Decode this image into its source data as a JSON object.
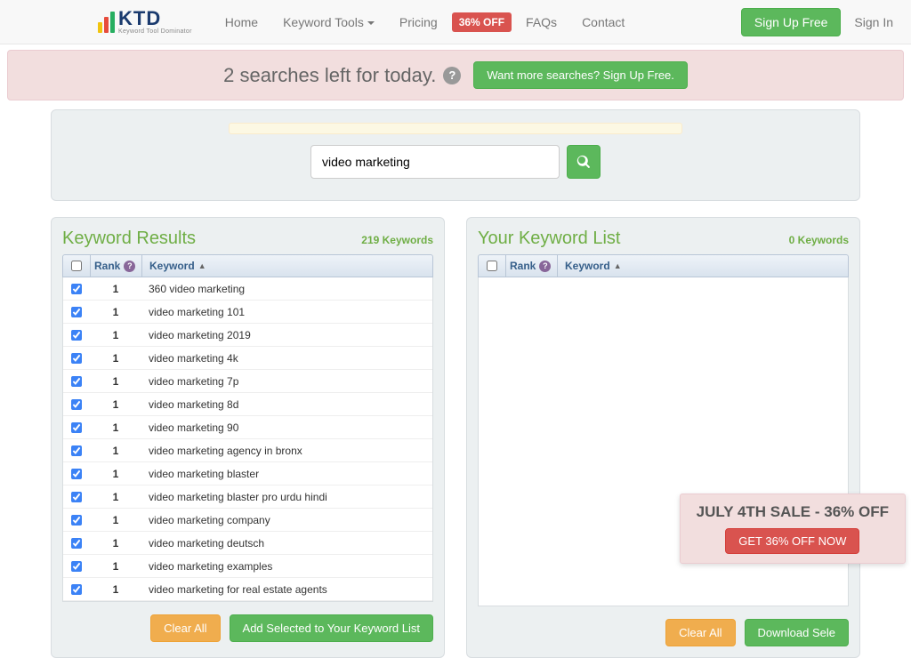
{
  "nav": {
    "brand_main": "KTD",
    "brand_sub": "Keyword Tool Dominator",
    "items": [
      "Home",
      "Keyword Tools",
      "Pricing",
      "FAQs",
      "Contact"
    ],
    "discount_badge": "36% OFF",
    "signup": "Sign Up Free",
    "signin": "Sign In"
  },
  "alert": {
    "message": "2 searches left for today.",
    "cta": "Want more searches? Sign Up Free."
  },
  "search": {
    "value": "video marketing"
  },
  "results": {
    "title": "Keyword Results",
    "count_label": "219 Keywords",
    "columns": {
      "rank": "Rank",
      "keyword": "Keyword"
    },
    "rows": [
      {
        "rank": "1",
        "keyword": "360 video marketing"
      },
      {
        "rank": "1",
        "keyword": "video marketing 101"
      },
      {
        "rank": "1",
        "keyword": "video marketing 2019"
      },
      {
        "rank": "1",
        "keyword": "video marketing 4k"
      },
      {
        "rank": "1",
        "keyword": "video marketing 7p"
      },
      {
        "rank": "1",
        "keyword": "video marketing 8d"
      },
      {
        "rank": "1",
        "keyword": "video marketing 90"
      },
      {
        "rank": "1",
        "keyword": "video marketing agency in bronx"
      },
      {
        "rank": "1",
        "keyword": "video marketing blaster"
      },
      {
        "rank": "1",
        "keyword": "video marketing blaster pro urdu hindi"
      },
      {
        "rank": "1",
        "keyword": "video marketing company"
      },
      {
        "rank": "1",
        "keyword": "video marketing deutsch"
      },
      {
        "rank": "1",
        "keyword": "video marketing examples"
      },
      {
        "rank": "1",
        "keyword": "video marketing for real estate agents"
      }
    ],
    "actions": {
      "clear": "Clear All",
      "add": "Add Selected to Your Keyword List"
    }
  },
  "list": {
    "title": "Your Keyword List",
    "count_label": "0 Keywords",
    "columns": {
      "rank": "Rank",
      "keyword": "Keyword"
    },
    "actions": {
      "clear": "Clear All",
      "download": "Download Sele"
    }
  },
  "promo": {
    "title": "JULY 4TH SALE - 36% OFF",
    "cta": "GET 36% OFF NOW"
  }
}
